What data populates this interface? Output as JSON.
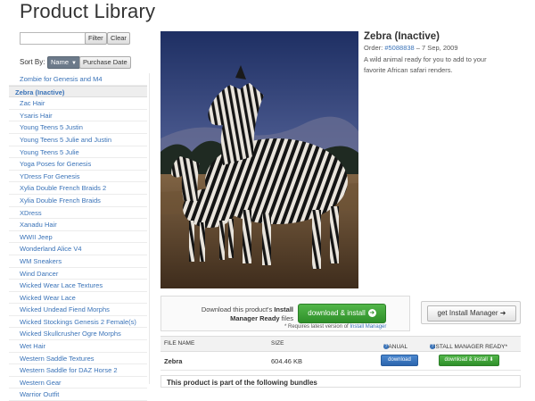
{
  "page": {
    "title": "Product Library"
  },
  "filter": {
    "placeholder": "",
    "filter_label": "Filter",
    "clear_label": "Clear"
  },
  "sort": {
    "label": "Sort By:",
    "selected": "Name",
    "alt_label": "Purchase Date"
  },
  "list": {
    "items": [
      {
        "label": "Zombie for Genesis and M4",
        "selected": false
      },
      {
        "label": "Zebra (Inactive)",
        "selected": true
      },
      {
        "label": "Zac Hair",
        "selected": false
      },
      {
        "label": "Ysaris Hair",
        "selected": false
      },
      {
        "label": "Young Teens 5 Justin",
        "selected": false
      },
      {
        "label": "Young Teens 5 Julie and Justin",
        "selected": false
      },
      {
        "label": "Young Teens 5 Julie",
        "selected": false
      },
      {
        "label": "Yoga Poses for Genesis",
        "selected": false
      },
      {
        "label": "YDress For Genesis",
        "selected": false
      },
      {
        "label": "Xylia Double French Braids 2",
        "selected": false
      },
      {
        "label": "Xylia Double French Braids",
        "selected": false
      },
      {
        "label": "XDress",
        "selected": false
      },
      {
        "label": "Xanadu Hair",
        "selected": false
      },
      {
        "label": "WWII Jeep",
        "selected": false
      },
      {
        "label": "Wonderland Alice V4",
        "selected": false
      },
      {
        "label": "WM Sneakers",
        "selected": false
      },
      {
        "label": "Wind Dancer",
        "selected": false
      },
      {
        "label": "Wicked Wear Lace Textures",
        "selected": false
      },
      {
        "label": "Wicked Wear Lace",
        "selected": false
      },
      {
        "label": "Wicked Undead Fiend Morphs",
        "selected": false
      },
      {
        "label": "Wicked Stockings Genesis 2 Female(s)",
        "selected": false
      },
      {
        "label": "Wicked Skullcrusher Ogre Morphs",
        "selected": false
      },
      {
        "label": "Wet Hair",
        "selected": false
      },
      {
        "label": "Western Saddle Textures",
        "selected": false
      },
      {
        "label": "Western Saddle for DAZ Horse 2",
        "selected": false
      },
      {
        "label": "Western Gear",
        "selected": false
      },
      {
        "label": "Warrior Outfit",
        "selected": false
      }
    ]
  },
  "product": {
    "name": "Zebra (Inactive)",
    "order_prefix": "Order: ",
    "order_number": "#5088838",
    "order_date": " – 7 Sep, 2009",
    "description": "A wild animal ready for you to add to your favorite African safari renders."
  },
  "download": {
    "text_before": "Download this product's ",
    "text_bold": "Install Manager Ready",
    "text_after": " files",
    "button_label": "download & install",
    "note_prefix": "* Requires latest version of ",
    "note_link": "Install Manager",
    "im_button_label": "get Install Manager"
  },
  "files": {
    "headers": {
      "file_name": "FILE NAME",
      "size": "SIZE",
      "manual": "MANUAL",
      "im_ready": "INSTALL MANAGER READY*"
    },
    "rows": [
      {
        "name": "Zebra",
        "size": "604.46 KB",
        "manual_label": "download",
        "im_label": "download & install"
      }
    ]
  },
  "next_section": {
    "title": "This product is part of the following bundles"
  },
  "colors": {
    "link": "#3a73b8",
    "green": "#2f8f2a",
    "blue": "#2c65ad"
  },
  "icons": {
    "qicon": "question-icon",
    "arrow": "arrow-right-icon",
    "download": "download-arrow-icon"
  }
}
